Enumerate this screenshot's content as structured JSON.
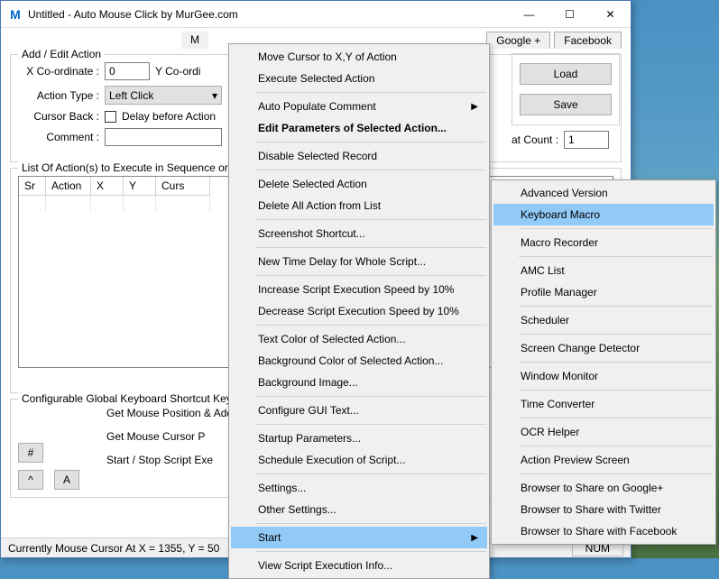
{
  "title": "Untitled - Auto Mouse Click by MurGee.com",
  "winbtns": {
    "min": "—",
    "max": "☐",
    "close": "✕"
  },
  "tabs": {
    "m": "M",
    "google": "Google +",
    "facebook": "Facebook"
  },
  "group1": {
    "title": "Add / Edit Action",
    "xlabel": "X Co-ordinate :",
    "xval": "0",
    "ylabel": "Y Co-ordi",
    "atype": "Action Type :",
    "atypeval": "Left Click",
    "cursorback": "Cursor Back :",
    "delay": "Delay before Action",
    "comment": "Comment :"
  },
  "right": {
    "load": "Load",
    "save": "Save",
    "repeat": "at Count :",
    "repeatval": "1"
  },
  "list": {
    "title": "List Of Action(s) to Execute in Sequence or",
    "cols": {
      "sr": "Sr",
      "action": "Action",
      "x": "X",
      "y": "Y",
      "curs": "Curs"
    }
  },
  "cfg": {
    "title": "Configurable Global Keyboard Shortcut Key",
    "l1": "Get Mouse Position & Add",
    "l2": "Get Mouse Cursor P",
    "l3": "Start / Stop Script Exe",
    "hash": "#",
    "caret": "^",
    "a": "A"
  },
  "status": {
    "text": "Currently Mouse Cursor At X = 1355, Y = 50",
    "num": "NUM"
  },
  "menu1": [
    {
      "t": "Move Cursor to X,Y of Action"
    },
    {
      "t": "Execute Selected Action"
    },
    {
      "sep": true
    },
    {
      "t": "Auto Populate Comment",
      "sub": true
    },
    {
      "t": "Edit Parameters of Selected Action...",
      "bold": true
    },
    {
      "sep": true
    },
    {
      "t": "Disable Selected Record"
    },
    {
      "sep": true
    },
    {
      "t": "Delete Selected Action"
    },
    {
      "t": "Delete All Action from List"
    },
    {
      "sep": true
    },
    {
      "t": "Screenshot Shortcut..."
    },
    {
      "sep": true
    },
    {
      "t": "New Time Delay for Whole Script..."
    },
    {
      "sep": true
    },
    {
      "t": "Increase Script Execution Speed by 10%"
    },
    {
      "t": "Decrease Script Execution Speed by 10%"
    },
    {
      "sep": true
    },
    {
      "t": "Text Color of Selected Action..."
    },
    {
      "t": "Background Color of Selected Action..."
    },
    {
      "t": "Background Image..."
    },
    {
      "sep": true
    },
    {
      "t": "Configure GUI Text..."
    },
    {
      "sep": true
    },
    {
      "t": "Startup Parameters..."
    },
    {
      "t": "Schedule Execution of Script..."
    },
    {
      "sep": true
    },
    {
      "t": "Settings..."
    },
    {
      "t": "Other Settings..."
    },
    {
      "sep": true
    },
    {
      "t": "Start",
      "sub": true,
      "hl": true
    },
    {
      "sep": true
    },
    {
      "t": "View Script Execution Info..."
    }
  ],
  "menu2": [
    {
      "t": "Advanced Version"
    },
    {
      "t": "Keyboard Macro",
      "hl": true
    },
    {
      "sep": true
    },
    {
      "t": "Macro Recorder"
    },
    {
      "sep": true
    },
    {
      "t": "AMC List"
    },
    {
      "t": "Profile Manager"
    },
    {
      "sep": true
    },
    {
      "t": "Scheduler"
    },
    {
      "sep": true
    },
    {
      "t": "Screen Change Detector"
    },
    {
      "sep": true
    },
    {
      "t": "Window Monitor"
    },
    {
      "sep": true
    },
    {
      "t": "Time Converter"
    },
    {
      "sep": true
    },
    {
      "t": "OCR Helper"
    },
    {
      "sep": true
    },
    {
      "t": "Action Preview Screen"
    },
    {
      "sep": true
    },
    {
      "t": "Browser to Share on Google+"
    },
    {
      "t": "Browser to Share with Twitter"
    },
    {
      "t": "Browser to Share with Facebook"
    }
  ]
}
